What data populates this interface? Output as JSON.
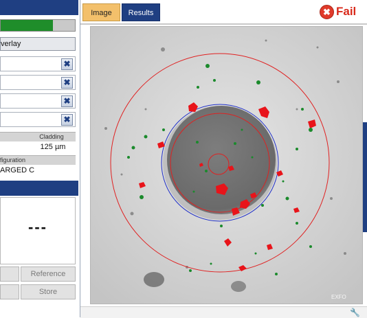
{
  "left": {
    "overlay_label": "verlay",
    "cladding_header": "Cladding",
    "cladding_value": "125 µm",
    "config_header": "figuration",
    "config_value": "ARGED C",
    "result_value": "---",
    "progress_fraction": 0.7,
    "reference_label": "Reference",
    "store_label": "Store",
    "clear_symbol": "✖"
  },
  "tabs": {
    "image_label": "Image",
    "results_label": "Results"
  },
  "status": {
    "fail_label": "Fail",
    "fail_symbol": "✖"
  },
  "image": {
    "watermark": "EXFO"
  },
  "colors": {
    "accent_blue": "#1f3f82",
    "tab_active": "#f3c06b",
    "fail_red": "#d92a1b",
    "progress_green": "#1f8d2a",
    "defect_red": "#e8141a",
    "scratch_green": "#1b8a2c",
    "zone_red": "#e02020",
    "zone_blue": "#2030c8"
  },
  "icons": {
    "clear_field": "x-icon",
    "fail": "fail-x-circle-icon",
    "status": "wrench-icon"
  }
}
